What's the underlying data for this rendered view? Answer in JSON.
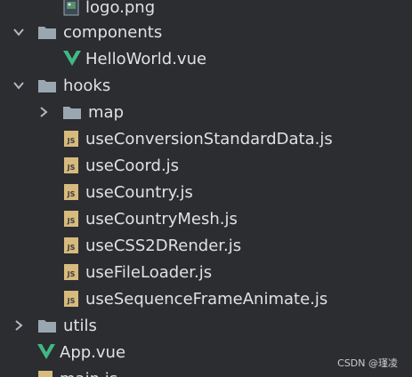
{
  "tree": {
    "items": [
      {
        "label": "logo.png",
        "icon": "image-file-icon",
        "expandable": false
      },
      {
        "label": "components",
        "icon": "folder-icon",
        "state": "expanded"
      },
      {
        "label": "HelloWorld.vue",
        "icon": "vue-file-icon"
      },
      {
        "label": "hooks",
        "icon": "folder-icon",
        "state": "expanded"
      },
      {
        "label": "map",
        "icon": "folder-icon",
        "state": "collapsed"
      },
      {
        "label": "useConversionStandardData.js",
        "icon": "js-file-icon"
      },
      {
        "label": "useCoord.js",
        "icon": "js-file-icon"
      },
      {
        "label": "useCountry.js",
        "icon": "js-file-icon"
      },
      {
        "label": "useCountryMesh.js",
        "icon": "js-file-icon"
      },
      {
        "label": "useCSS2DRender.js",
        "icon": "js-file-icon"
      },
      {
        "label": "useFileLoader.js",
        "icon": "js-file-icon"
      },
      {
        "label": "useSequenceFrameAnimate.js",
        "icon": "js-file-icon"
      },
      {
        "label": "utils",
        "icon": "folder-icon",
        "state": "collapsed"
      },
      {
        "label": "App.vue",
        "icon": "vue-file-icon"
      },
      {
        "label": "main.js",
        "icon": "js-file-icon"
      }
    ]
  },
  "watermark": {
    "text": "CSDN @瑾凌"
  },
  "colors": {
    "background": "#2b2d30",
    "text": "#dfe1e5",
    "folder": "#9aa7b0",
    "vue_green": "#41b883",
    "js_yellow": "#d7ba7d",
    "chevron": "#b4b8bf"
  }
}
